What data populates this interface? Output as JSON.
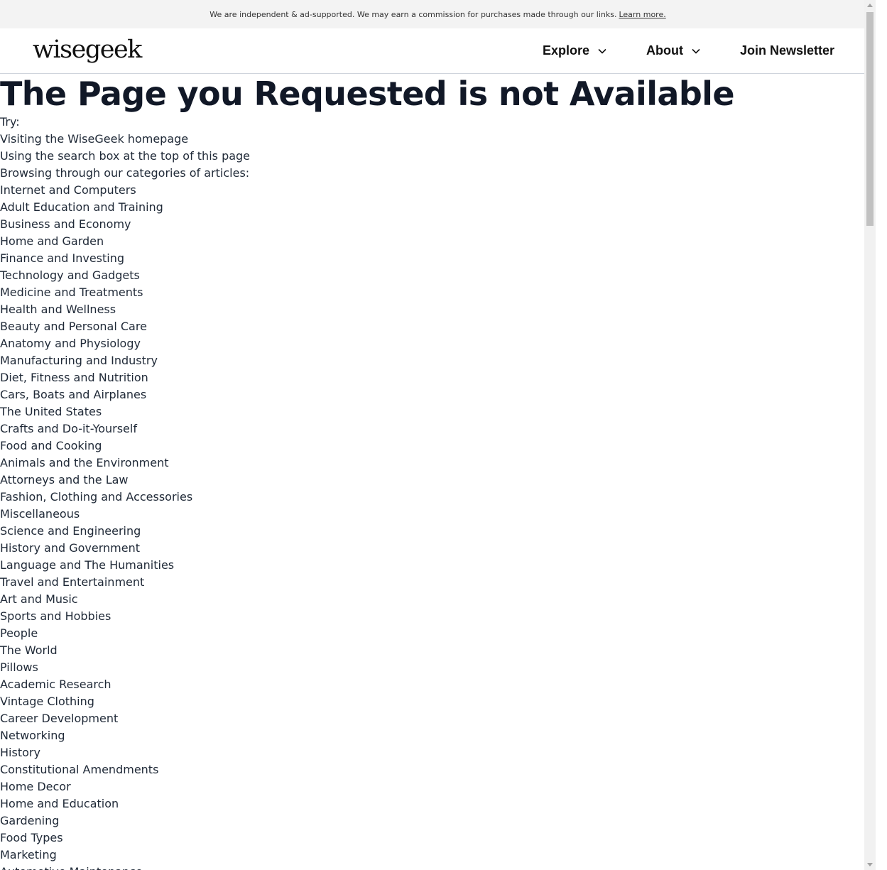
{
  "topbar": {
    "notice": "We are independent & ad-supported. We may earn a commission for purchases made through our links.",
    "learn_more": "Learn more."
  },
  "header": {
    "logo": "wisegeek",
    "nav": {
      "explore": "Explore",
      "about": "About",
      "newsletter": "Join Newsletter"
    }
  },
  "main": {
    "title": "The Page you Requested is not Available",
    "try_label": "Try:",
    "suggestions": [
      "Visiting the WiseGeek homepage",
      "Using the search box at the top of this page",
      "Browsing through our categories of articles:"
    ],
    "categories": [
      "Internet and Computers",
      "Adult Education and Training",
      "Business and Economy",
      "Home and Garden",
      "Finance and Investing",
      "Technology and Gadgets",
      "Medicine and Treatments",
      "Health and Wellness",
      "Beauty and Personal Care",
      "Anatomy and Physiology",
      "Manufacturing and Industry",
      "Diet, Fitness and Nutrition",
      "Cars, Boats and Airplanes",
      "The United States",
      "Crafts and Do-it-Yourself",
      "Food and Cooking",
      "Animals and the Environment",
      "Attorneys and the Law",
      "Fashion, Clothing and Accessories",
      "Miscellaneous",
      "Science and Engineering",
      "History and Government",
      "Language and The Humanities",
      "Travel and Entertainment",
      "Art and Music",
      "Sports and Hobbies",
      "People",
      "The World",
      "Pillows",
      "Academic Research",
      "Vintage Clothing",
      "Career Development",
      "Networking",
      "History",
      "Constitutional Amendments",
      "Home Decor",
      "Home and Education",
      "Gardening",
      "Food Types",
      "Marketing",
      "Automotive Maintenance"
    ]
  }
}
